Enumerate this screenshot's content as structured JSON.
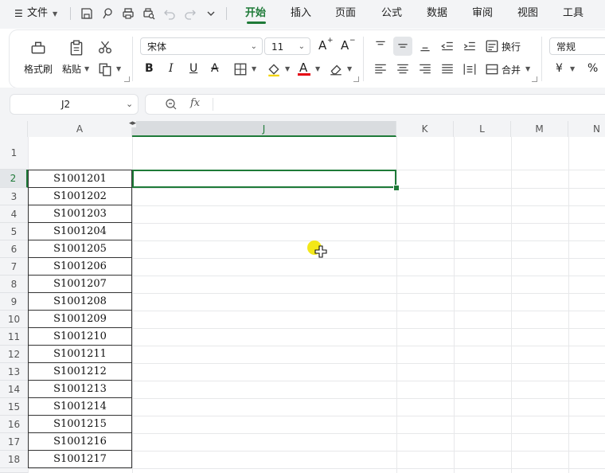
{
  "menu": {
    "hamburger": "☰",
    "file": "文件",
    "tabs": [
      {
        "label": "开始",
        "active": true
      },
      {
        "label": "插入",
        "active": false
      },
      {
        "label": "页面",
        "active": false
      },
      {
        "label": "公式",
        "active": false
      },
      {
        "label": "数据",
        "active": false
      },
      {
        "label": "审阅",
        "active": false
      },
      {
        "label": "视图",
        "active": false
      },
      {
        "label": "工具",
        "active": false
      }
    ]
  },
  "ribbon": {
    "format_painter": "格式刷",
    "paste": "粘贴",
    "font_name": "宋体",
    "font_size": "11",
    "wrap": "换行",
    "merge": "合并",
    "number_format": "常规",
    "currency": "¥",
    "percent": "%",
    "bold": "B",
    "italic": "I",
    "underline": "U",
    "strike": "A",
    "grow_font": "A",
    "shrink_font": "A",
    "font_color_letter": "A"
  },
  "formula_bar": {
    "name_box": "J2",
    "fx": "fx",
    "value": ""
  },
  "grid": {
    "columns": [
      "A",
      "J",
      "K",
      "L",
      "M",
      "N"
    ],
    "selected_column": "J",
    "selected_row": "2",
    "rows": [
      "1",
      "2",
      "3",
      "4",
      "5",
      "6",
      "7",
      "8",
      "9",
      "10",
      "11",
      "12",
      "13",
      "14",
      "15",
      "16",
      "17",
      "18"
    ],
    "column_a_values": [
      "",
      "S1001201",
      "S1001202",
      "S1001203",
      "S1001204",
      "S1001205",
      "S1001206",
      "S1001207",
      "S1001208",
      "S1001209",
      "S1001210",
      "S1001211",
      "S1001212",
      "S1001213",
      "S1001214",
      "S1001215",
      "S1001216",
      "S1001217"
    ],
    "hidden_columns_marker": "◂▸"
  },
  "colors": {
    "accent": "#1e7a38",
    "font_color_swatch": "#e60012",
    "toolbar_bg": "#f3f4f6"
  }
}
